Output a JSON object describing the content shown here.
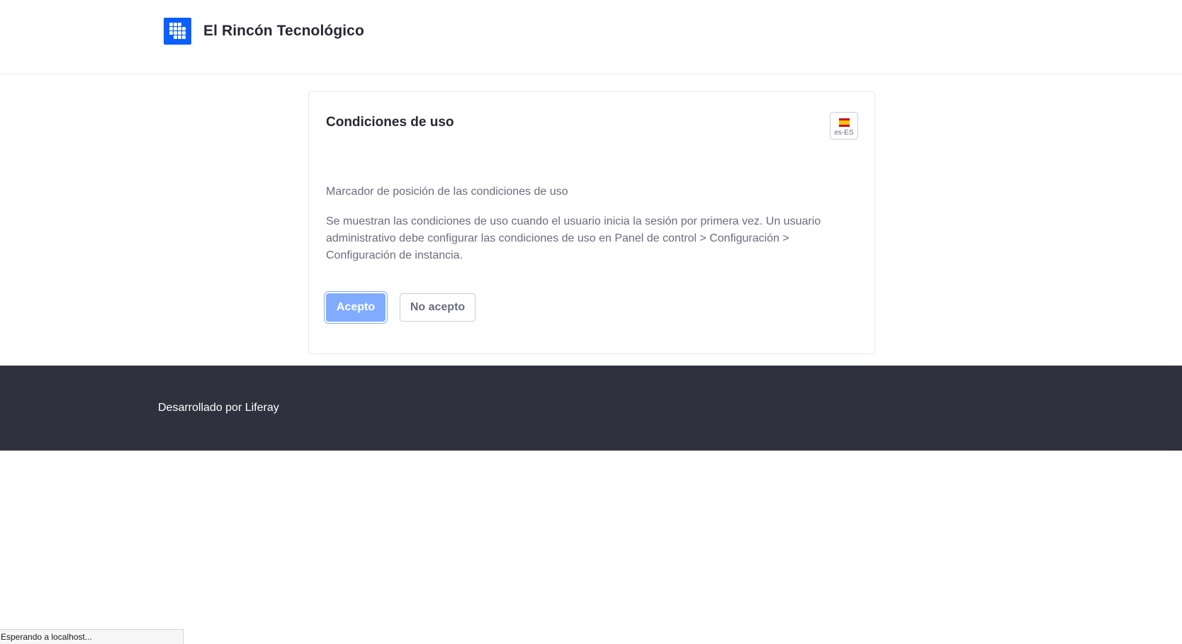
{
  "header": {
    "site_title": "El Rincón Tecnológico",
    "logo_icon": "site-logo-grid-icon",
    "logo_color": "#0b5fff"
  },
  "terms": {
    "title": "Condiciones de uso",
    "language": {
      "flag_icon": "spain-flag-icon",
      "label": "es-ES"
    },
    "placeholder": "Marcador de posición de las condiciones de uso",
    "description": "Se muestran las condiciones de uso cuando el usuario inicia la sesión por primera vez. Un usuario administrativo debe configurar las condiciones de uso en Panel de control > Configuración > Configuración de instancia.",
    "accept_label": "Acepto",
    "decline_label": "No acepto",
    "accept_color": "#80acff"
  },
  "footer": {
    "powered_by": "Desarrollado por Liferay",
    "background_color": "#30313f"
  },
  "browser_status": {
    "text": "Esperando a localhost..."
  }
}
